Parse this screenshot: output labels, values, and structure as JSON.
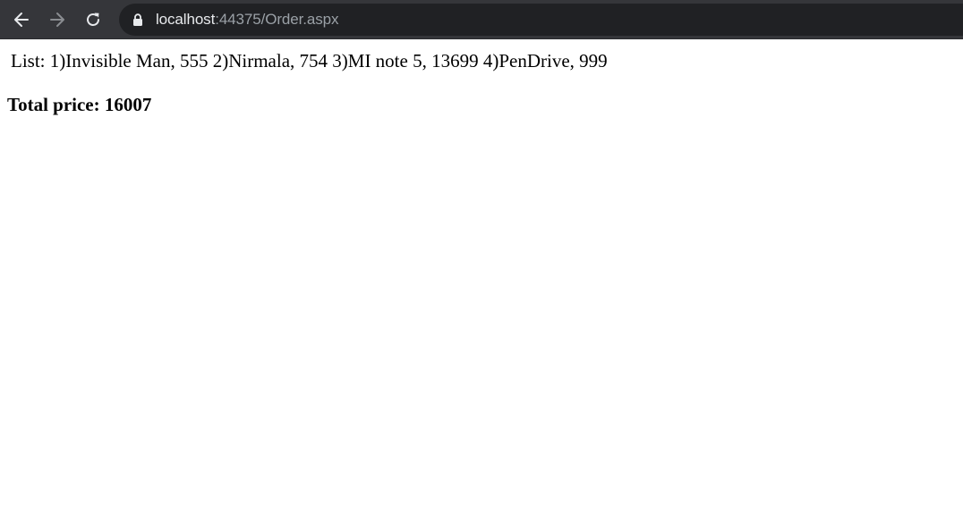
{
  "browser": {
    "url_host": "localhost",
    "url_rest": ":44375/Order.aspx",
    "icons": {
      "back": "back-arrow-icon",
      "forward": "forward-arrow-icon",
      "reload": "reload-icon",
      "lock": "lock-icon"
    },
    "colors": {
      "toolbar": "#35363a",
      "omnibox": "#202124",
      "url_host": "#e8eaed",
      "url_rest": "#9aa0a6"
    }
  },
  "page": {
    "order_list_text": "List: 1)Invisible Man, 555 2)Nirmala, 754 3)MI note 5, 13699 4)PenDrive, 999",
    "total_text": "Total price: 16007"
  }
}
